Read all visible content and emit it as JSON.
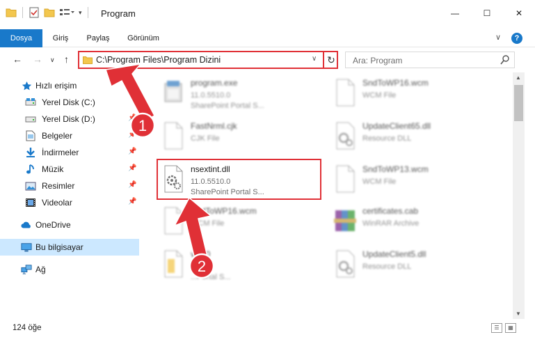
{
  "window": {
    "title": "Program"
  },
  "window_controls": {
    "minimize": "—",
    "maximize": "☐",
    "close": "✕"
  },
  "ribbon": {
    "tabs": [
      "Dosya",
      "Giriş",
      "Paylaş",
      "Görünüm"
    ],
    "help": "?",
    "accent": "#1979ca"
  },
  "address": {
    "path": "C:\\Program Files\\Program Dizini",
    "refresh": "↻"
  },
  "search": {
    "placeholder": "Ara: Program"
  },
  "sidebar": {
    "quick_access": "Hızlı erişim",
    "items": [
      {
        "label": "Yerel Disk (C:)",
        "icon": "drive-icon",
        "pinned": false
      },
      {
        "label": "Yerel Disk (D:)",
        "icon": "drive-icon",
        "pinned": true
      },
      {
        "label": "Belgeler",
        "icon": "documents-icon",
        "pinned": true
      },
      {
        "label": "İndirmeler",
        "icon": "download-icon",
        "pinned": true
      },
      {
        "label": "Müzik",
        "icon": "music-icon",
        "pinned": true
      },
      {
        "label": "Resimler",
        "icon": "pictures-icon",
        "pinned": true
      },
      {
        "label": "Videolar",
        "icon": "videos-icon",
        "pinned": true
      }
    ],
    "onedrive": "OneDrive",
    "this_pc": "Bu bilgisayar",
    "network": "Ağ"
  },
  "files": [
    {
      "name": "program.exe",
      "line2": "11.0.5510.0",
      "line3": "SharePoint Portal S...",
      "icon": "exe-icon"
    },
    {
      "name": "SndToWP16.wcm",
      "line2": "WCM File",
      "line3": "",
      "icon": "blank-file-icon"
    },
    {
      "name": "FastNrml.cjk",
      "line2": "CJK File",
      "line3": "",
      "icon": "blank-file-icon"
    },
    {
      "name": "UpdateClient65.dll",
      "line2": "Resource DLL",
      "line3": "",
      "icon": "dll-icon"
    },
    {
      "name": "nsextint.dll",
      "line2": "11.0.5510.0",
      "line3": "SharePoint Portal S...",
      "icon": "dll-icon"
    },
    {
      "name": "SndToWP13.wcm",
      "line2": "WCM File",
      "line3": "",
      "icon": "blank-file-icon"
    },
    {
      "name": "SndToWP16.wcm",
      "line2": "WCM File",
      "line3": "",
      "icon": "blank-file-icon"
    },
    {
      "name": "certificates.cab",
      "line2": "WinRAR Archive",
      "line3": "",
      "icon": "winrar-icon"
    },
    {
      "name": "v.....0",
      "line2": "...0",
      "line3": "...Portal S...",
      "icon": "blank-file-icon"
    },
    {
      "name": "UpdateClient5.dll",
      "line2": "Resource DLL",
      "line3": "",
      "icon": "dll-icon"
    }
  ],
  "status": {
    "count": "124 öğe"
  },
  "annotations": {
    "step1": "1",
    "step2": "2",
    "color": "#e03036"
  }
}
